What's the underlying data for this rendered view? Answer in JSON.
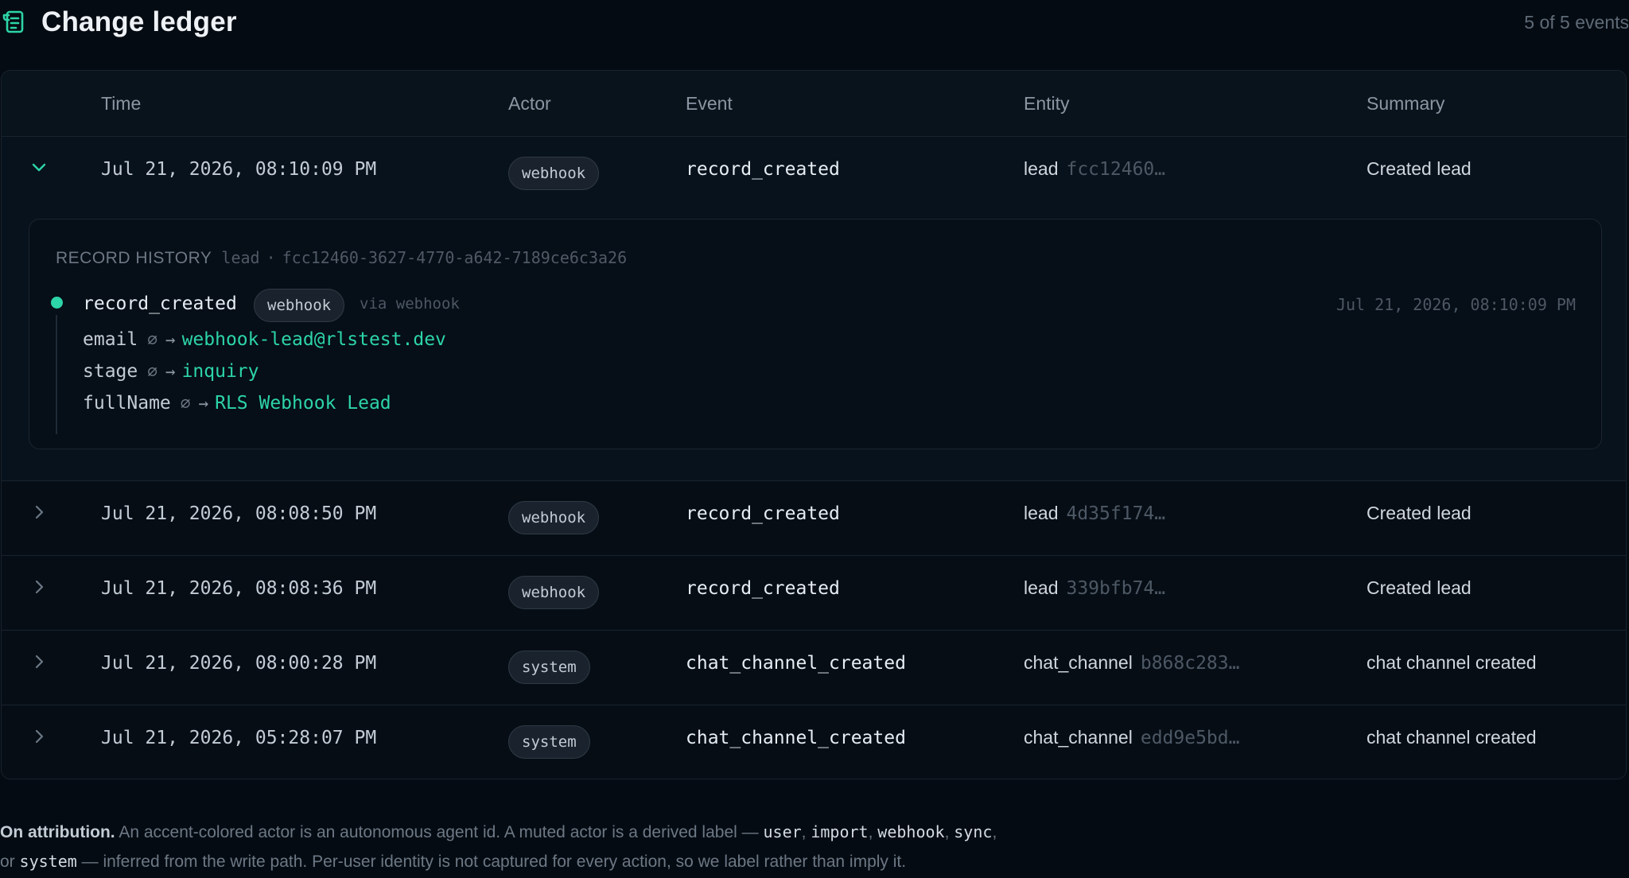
{
  "header": {
    "title": "Change ledger",
    "count": "5 of 5 events",
    "logo_icon": "ledger-scroll-icon"
  },
  "colors": {
    "accent": "#2dd4a7",
    "background": "#050b12",
    "muted": "#6c7885"
  },
  "table": {
    "columns": [
      "Time",
      "Actor",
      "Event",
      "Entity",
      "Summary"
    ],
    "rows": [
      {
        "expanded": true,
        "time": "Jul 21, 2026, 08:10:09 PM",
        "actor": "webhook",
        "event": "record_created",
        "entity_type": "lead",
        "entity_id": "fcc12460…",
        "summary": "Created lead"
      },
      {
        "expanded": false,
        "time": "Jul 21, 2026, 08:08:50 PM",
        "actor": "webhook",
        "event": "record_created",
        "entity_type": "lead",
        "entity_id": "4d35f174…",
        "summary": "Created lead"
      },
      {
        "expanded": false,
        "time": "Jul 21, 2026, 08:08:36 PM",
        "actor": "webhook",
        "event": "record_created",
        "entity_type": "lead",
        "entity_id": "339bfb74…",
        "summary": "Created lead"
      },
      {
        "expanded": false,
        "time": "Jul 21, 2026, 08:00:28 PM",
        "actor": "system",
        "event": "chat_channel_created",
        "entity_type": "chat_channel",
        "entity_id": "b868c283…",
        "summary": "chat channel created"
      },
      {
        "expanded": false,
        "time": "Jul 21, 2026, 05:28:07 PM",
        "actor": "system",
        "event": "chat_channel_created",
        "entity_type": "chat_channel",
        "entity_id": "edd9e5bd…",
        "summary": "chat channel created"
      }
    ]
  },
  "history": {
    "label": "RECORD HISTORY",
    "entity_type": "lead",
    "separator": "·",
    "entity_id": "fcc12460-3627-4770-a642-7189ce6c3a26",
    "event": "record_created",
    "actor": "webhook",
    "via": "via webhook",
    "time": "Jul 21, 2026, 08:10:09 PM",
    "changes": [
      {
        "field": "email",
        "from": "∅",
        "arrow": "→",
        "to": "webhook-lead@rlstest.dev"
      },
      {
        "field": "stage",
        "from": "∅",
        "arrow": "→",
        "to": "inquiry"
      },
      {
        "field": "fullName",
        "from": "∅",
        "arrow": "→",
        "to": "RLS Webhook Lead"
      }
    ]
  },
  "note": {
    "lead": "On attribution.",
    "text1": "An accent-colored actor is an autonomous agent id. A muted actor is a derived label —",
    "labels": [
      "user",
      "import",
      "webhook",
      "sync",
      "system"
    ],
    "sep_comma": ",",
    "or_text": "or",
    "text2": "— inferred from the write path. Per-user identity is not captured for every action, so we label rather than imply it."
  }
}
